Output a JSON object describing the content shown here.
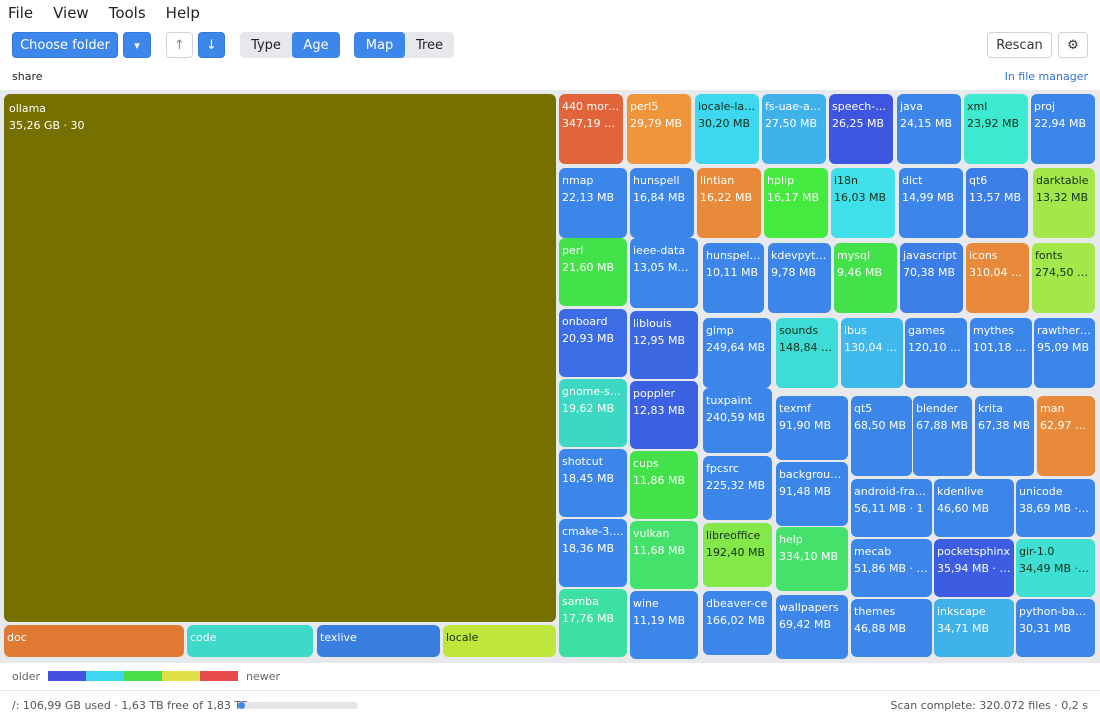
{
  "menu": [
    "File",
    "View",
    "Tools",
    "Help"
  ],
  "toolbar": {
    "choose_folder": "Choose folder",
    "dropdown_glyph": "▾",
    "up_glyph": "↑",
    "down_glyph": "↓",
    "type": "Type",
    "age": "Age",
    "map": "Map",
    "tree": "Tree",
    "rescan": "Rescan",
    "settings_glyph": "⚙"
  },
  "path": {
    "current": "share",
    "file_manager": "In file manager"
  },
  "colors": {
    "accent": "#3d86ea",
    "age_scale": [
      "#4450e0",
      "#3fd8f0",
      "#48e048",
      "#e0e048",
      "#e84b4b"
    ]
  },
  "treemap": [
    {
      "name": "ollama",
      "size": "35,26 GB · 30",
      "color": "#767000"
    },
    {
      "name": "doc",
      "size": "",
      "color": "#e07a32"
    },
    {
      "name": "code",
      "size": "",
      "color": "#3fd9c9"
    },
    {
      "name": "texlive",
      "size": "",
      "color": "#3a7ee0"
    },
    {
      "name": "locale",
      "size": "",
      "color": "#bfe63b"
    },
    {
      "name": "440 more…",
      "size": "347,19 MB",
      "color": "#e2643a"
    },
    {
      "name": "perl5",
      "size": "29,79 MB",
      "color": "#f0953c"
    },
    {
      "name": "locale-la…",
      "size": "30,20 MB",
      "color": "#3dd8ef"
    },
    {
      "name": "fs-uae-ar…",
      "size": "27,50 MB",
      "color": "#3fb2ec"
    },
    {
      "name": "speech-d…",
      "size": "26,25 MB",
      "color": "#3e55e0"
    },
    {
      "name": "java",
      "size": "24,15 MB",
      "color": "#3c86ea"
    },
    {
      "name": "xml",
      "size": "23,92 MB",
      "color": "#3deacf"
    },
    {
      "name": "proj",
      "size": "22,94 MB",
      "color": "#3c86ea"
    },
    {
      "name": "nmap",
      "size": "22,13 MB",
      "color": "#3c86ea"
    },
    {
      "name": "hunspell",
      "size": "16,84 MB",
      "color": "#3c86ea"
    },
    {
      "name": "lintian",
      "size": "16,22 MB",
      "color": "#e88a3a"
    },
    {
      "name": "hplip",
      "size": "16,17 MB",
      "color": "#44ea3d"
    },
    {
      "name": "i18n",
      "size": "16,03 MB",
      "color": "#3fe0ea"
    },
    {
      "name": "dict",
      "size": "14,99 MB",
      "color": "#3c86ea"
    },
    {
      "name": "qt6",
      "size": "13,57 MB",
      "color": "#3c7de8"
    },
    {
      "name": "darktable",
      "size": "13,32 MB",
      "color": "#a2e84a"
    },
    {
      "name": "perl",
      "size": "21,60 MB",
      "color": "#44e24a"
    },
    {
      "name": "ieee-data",
      "size": "13,05 MB · 9",
      "color": "#3c86ea"
    },
    {
      "name": "hunspell…",
      "size": "10,11 MB",
      "color": "#3c86ea"
    },
    {
      "name": "kdevpyt…",
      "size": "9,78 MB",
      "color": "#3c86ea"
    },
    {
      "name": "mysql",
      "size": "9,46 MB",
      "color": "#44e24a"
    },
    {
      "name": "javascript",
      "size": "70,38 MB",
      "color": "#3c7de8"
    },
    {
      "name": "icons",
      "size": "310,04 MB",
      "color": "#e88a3a"
    },
    {
      "name": "fonts",
      "size": "274,50 MB",
      "color": "#a2e84a"
    },
    {
      "name": "onboard",
      "size": "20,93 MB",
      "color": "#3c6de6"
    },
    {
      "name": "liblouis",
      "size": "12,95 MB",
      "color": "#3c68e4"
    },
    {
      "name": "gimp",
      "size": "249,64 MB",
      "color": "#3c86ea"
    },
    {
      "name": "sounds",
      "size": "148,84 MB",
      "color": "#3ddcd6"
    },
    {
      "name": "ibus",
      "size": "130,04 MB",
      "color": "#3fb8ec"
    },
    {
      "name": "games",
      "size": "120,10 MB",
      "color": "#3c86ea"
    },
    {
      "name": "mythes",
      "size": "101,18 MB",
      "color": "#3c86ea"
    },
    {
      "name": "rawthera…",
      "size": "95,09 MB",
      "color": "#3c86ea"
    },
    {
      "name": "gnome-sh…",
      "size": "19,62 MB",
      "color": "#3dd8c4"
    },
    {
      "name": "poppler",
      "size": "12,83 MB",
      "color": "#3c60e2"
    },
    {
      "name": "tuxpaint",
      "size": "240,59 MB",
      "color": "#3c86ea"
    },
    {
      "name": "texmf",
      "size": "91,90 MB",
      "color": "#3c86ea"
    },
    {
      "name": "qt5",
      "size": "68,50 MB",
      "color": "#3c86ea"
    },
    {
      "name": "blender",
      "size": "67,88 MB",
      "color": "#3c86ea"
    },
    {
      "name": "krita",
      "size": "67,38 MB",
      "color": "#3c86ea"
    },
    {
      "name": "man",
      "size": "62,97 MB",
      "color": "#e88a3a"
    },
    {
      "name": "shotcut",
      "size": "18,45 MB",
      "color": "#3c86ea"
    },
    {
      "name": "cups",
      "size": "11,86 MB",
      "color": "#44e24a"
    },
    {
      "name": "fpcsrc",
      "size": "225,32 MB",
      "color": "#3c86ea"
    },
    {
      "name": "backgroun…",
      "size": "91,48 MB",
      "color": "#3c86ea"
    },
    {
      "name": "android-fra…",
      "size": "56,11 MB · 1",
      "color": "#3c86ea"
    },
    {
      "name": "kdenlive",
      "size": "46,60 MB",
      "color": "#3c86ea"
    },
    {
      "name": "unicode",
      "size": "38,69 MB · 79",
      "color": "#3c86ea"
    },
    {
      "name": "cmake-3.28",
      "size": "18,36 MB",
      "color": "#3c86ea"
    },
    {
      "name": "vulkan",
      "size": "11,68 MB",
      "color": "#44e26a"
    },
    {
      "name": "libreoffice",
      "size": "192,40 MB",
      "color": "#84e84a"
    },
    {
      "name": "help",
      "size": "334,10 MB",
      "color": "#44e26a"
    },
    {
      "name": "mecab",
      "size": "51,86 MB · 35",
      "color": "#3c86ea"
    },
    {
      "name": "pocketsphinx",
      "size": "35,94 MB · 11",
      "color": "#3c5ce2"
    },
    {
      "name": "gir-1.0",
      "size": "34,49 MB · 40",
      "color": "#3de0d2"
    },
    {
      "name": "samba",
      "size": "17,76 MB",
      "color": "#3de0a4"
    },
    {
      "name": "wine",
      "size": "11,19 MB",
      "color": "#3c86ea"
    },
    {
      "name": "dbeaver-ce",
      "size": "166,02 MB",
      "color": "#3c86ea"
    },
    {
      "name": "wallpapers",
      "size": "69,42 MB",
      "color": "#3c86ea"
    },
    {
      "name": "themes",
      "size": "46,88 MB",
      "color": "#3c86ea"
    },
    {
      "name": "inkscape",
      "size": "34,71 MB",
      "color": "#3fb2ec"
    },
    {
      "name": "python-bab…",
      "size": "30,31 MB",
      "color": "#3c86ea"
    }
  ],
  "legend": {
    "older": "older",
    "newer": "newer"
  },
  "status": {
    "disk": "/:  106,99 GB used · 1,63 TB free of 1,83 TB",
    "disk_used_fraction": 0.057,
    "scan": "Scan complete: 320.072 files  ·  0,2 s"
  }
}
